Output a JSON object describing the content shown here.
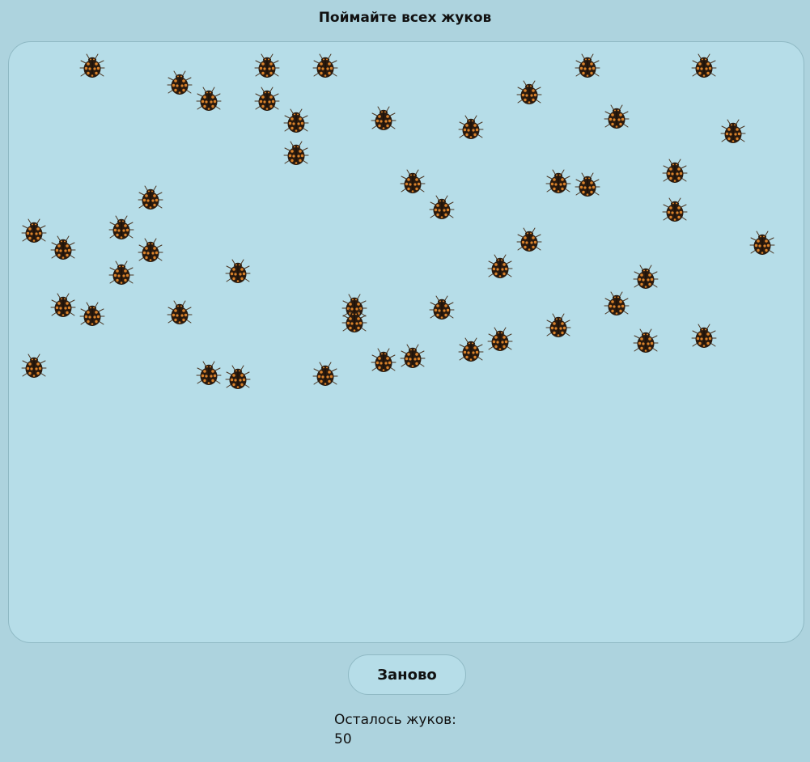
{
  "game": {
    "title": "Поймайте всех жуков",
    "restart_label": "Заново",
    "remaining_label": "Осталось жуков:",
    "remaining_count": "50",
    "bug_icon": "ladybug-icon",
    "colors": {
      "page_background": "#add3de",
      "field_background": "#b6dde8",
      "bug_body": "#2a1a0e",
      "bug_spots": "#d9822b"
    }
  }
}
